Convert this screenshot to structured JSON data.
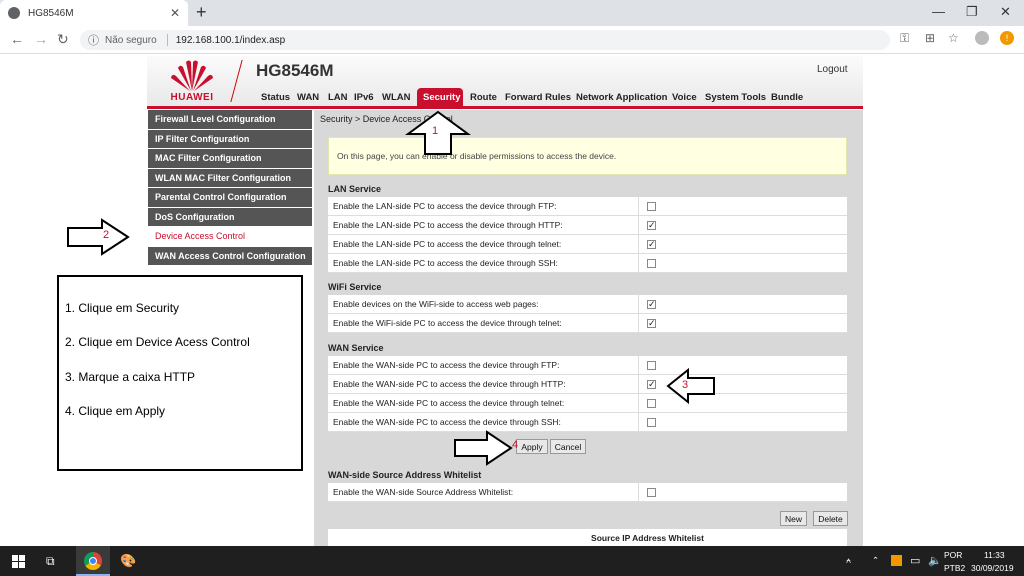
{
  "browser": {
    "tab_title": "HG8546M",
    "security_label": "Não seguro",
    "url": "192.168.100.1/index.asp"
  },
  "router": {
    "brand": "HUAWEI",
    "model": "HG8546M",
    "logout": "Logout",
    "menu": [
      "Status",
      "WAN",
      "LAN",
      "IPv6",
      "WLAN",
      "Security",
      "Route",
      "Forward Rules",
      "Network Application",
      "Voice",
      "System Tools",
      "Bundle"
    ],
    "active_menu": "Security",
    "side_nav": [
      "Firewall Level Configuration",
      "IP Filter Configuration",
      "MAC Filter Configuration",
      "WLAN MAC Filter Configuration",
      "Parental Control Configuration",
      "DoS Configuration",
      "Device Access Control",
      "WAN Access Control Configuration"
    ],
    "active_side": "Device Access Control",
    "breadcrumb": "Security > Device Access Control",
    "note": "On this page, you can enable or disable permissions to access the device.",
    "lan": {
      "title": "LAN Service",
      "rows": [
        {
          "label": "Enable the LAN-side PC to access the device through FTP:",
          "checked": false
        },
        {
          "label": "Enable the LAN-side PC to access the device through HTTP:",
          "checked": true
        },
        {
          "label": "Enable the LAN-side PC to access the device through telnet:",
          "checked": true
        },
        {
          "label": "Enable the LAN-side PC to access the device through SSH:",
          "checked": false
        }
      ]
    },
    "wifi": {
      "title": "WiFi Service",
      "rows": [
        {
          "label": "Enable devices on the WiFi-side to access web pages:",
          "checked": true
        },
        {
          "label": "Enable the WiFi-side PC to access the device through telnet:",
          "checked": true
        }
      ]
    },
    "wan": {
      "title": "WAN Service",
      "rows": [
        {
          "label": "Enable the WAN-side PC to access the device through FTP:",
          "checked": false
        },
        {
          "label": "Enable the WAN-side PC to access the device through HTTP:",
          "checked": true
        },
        {
          "label": "Enable the WAN-side PC to access the device through telnet:",
          "checked": false
        },
        {
          "label": "Enable the WAN-side PC to access the device through SSH:",
          "checked": false
        }
      ]
    },
    "apply": "Apply",
    "cancel": "Cancel",
    "whitelist": {
      "title": "WAN-side Source Address Whitelist",
      "row_label": "Enable the WAN-side Source Address Whitelist:",
      "checked": false,
      "new": "New",
      "delete": "Delete",
      "table_header": "Source IP Address Whitelist"
    }
  },
  "annotation": {
    "steps": [
      "1. Clique em Security",
      "2. Clique em Device Acess Control",
      "3. Marque a caixa HTTP",
      "4. Clique em Apply"
    ],
    "markers": [
      "1",
      "2",
      "3",
      "4"
    ]
  },
  "taskbar": {
    "lang": "POR",
    "layout": "PTB2",
    "time": "11:33",
    "date": "30/09/2019"
  }
}
